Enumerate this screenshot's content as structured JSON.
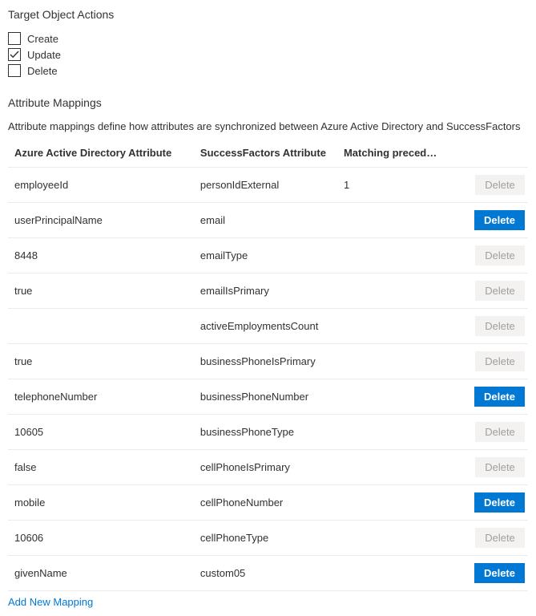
{
  "targetActions": {
    "title": "Target Object Actions",
    "items": [
      {
        "label": "Create",
        "checked": false
      },
      {
        "label": "Update",
        "checked": true
      },
      {
        "label": "Delete",
        "checked": false
      }
    ]
  },
  "mappings": {
    "title": "Attribute Mappings",
    "description": "Attribute mappings define how attributes are synchronized between Azure Active Directory and SuccessFactors",
    "headers": {
      "aad": "Azure Active Directory Attribute",
      "sf": "SuccessFactors Attribute",
      "mp": "Matching preceden...",
      "act": ""
    },
    "rows": [
      {
        "aad": "employeeId",
        "sf": "personIdExternal",
        "mp": "1",
        "deleteEnabled": false
      },
      {
        "aad": "userPrincipalName",
        "sf": "email",
        "mp": "",
        "deleteEnabled": true
      },
      {
        "aad": "8448",
        "sf": "emailType",
        "mp": "",
        "deleteEnabled": false
      },
      {
        "aad": "true",
        "sf": "emailIsPrimary",
        "mp": "",
        "deleteEnabled": false
      },
      {
        "aad": "",
        "sf": "activeEmploymentsCount",
        "mp": "",
        "deleteEnabled": false
      },
      {
        "aad": "true",
        "sf": "businessPhoneIsPrimary",
        "mp": "",
        "deleteEnabled": false
      },
      {
        "aad": "telephoneNumber",
        "sf": "businessPhoneNumber",
        "mp": "",
        "deleteEnabled": true
      },
      {
        "aad": "10605",
        "sf": "businessPhoneType",
        "mp": "",
        "deleteEnabled": false
      },
      {
        "aad": "false",
        "sf": "cellPhoneIsPrimary",
        "mp": "",
        "deleteEnabled": false
      },
      {
        "aad": "mobile",
        "sf": "cellPhoneNumber",
        "mp": "",
        "deleteEnabled": true
      },
      {
        "aad": "10606",
        "sf": "cellPhoneType",
        "mp": "",
        "deleteEnabled": false
      },
      {
        "aad": "givenName",
        "sf": "custom05",
        "mp": "",
        "deleteEnabled": true
      }
    ],
    "deleteLabel": "Delete",
    "addNewLabel": "Add New Mapping"
  }
}
